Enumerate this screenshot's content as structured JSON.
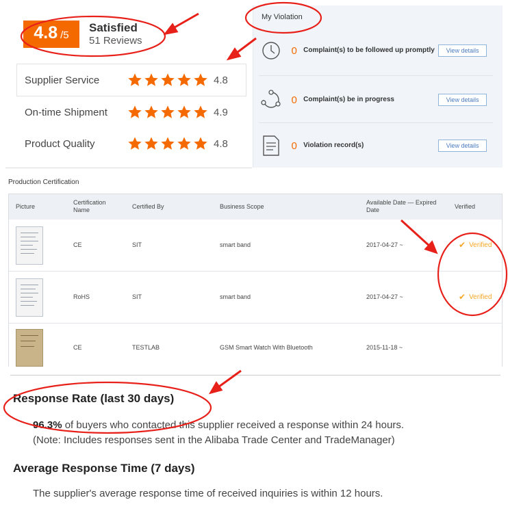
{
  "rating": {
    "score": "4.8",
    "out_of": "/5",
    "status": "Satisfied",
    "reviews": "51 Reviews",
    "metrics": [
      {
        "label": "Supplier Service",
        "value": "4.8",
        "stars": 5
      },
      {
        "label": "On-time Shipment",
        "value": "4.9",
        "stars": 5
      },
      {
        "label": "Product Quality",
        "value": "4.8",
        "stars": 5
      }
    ]
  },
  "violation": {
    "title": "My Violation",
    "items": [
      {
        "count": "0",
        "text": "Complaint(s) to be followed up promptly",
        "button": "View details",
        "icon": "clock-icon"
      },
      {
        "count": "0",
        "text": "Complaint(s) be in progress",
        "button": "View details",
        "icon": "cycle-icon"
      },
      {
        "count": "0",
        "text": "Violation record(s)",
        "button": "View details",
        "icon": "document-icon"
      }
    ]
  },
  "certification": {
    "title": "Production Certification",
    "headers": [
      "Picture",
      "Certification Name",
      "Certified By",
      "Business Scope",
      "Available Date — Expired Date",
      "Verified"
    ],
    "rows": [
      {
        "name": "CE",
        "by": "SIT",
        "scope": "smart band",
        "date": "2017-04-27 ~",
        "verified": "Verified"
      },
      {
        "name": "RoHS",
        "by": "SIT",
        "scope": "smart band",
        "date": "2017-04-27 ~",
        "verified": "Verified"
      },
      {
        "name": "CE",
        "by": "TESTLAB",
        "scope": "GSM Smart Watch With Bluetooth",
        "date": "2015-11-18 ~",
        "verified": ""
      }
    ]
  },
  "response": {
    "rate_heading": "Response Rate (last 30 days)",
    "rate_value": "96.3%",
    "rate_text": " of buyers who contacted this supplier received a response within 24 hours.",
    "rate_note": "(Note: Includes responses sent in the Alibaba Trade Center and TradeManager)",
    "time_heading": "Average Response Time (7 days)",
    "time_text": "The supplier's average response time of received inquiries is within 12 hours."
  },
  "colors": {
    "accent": "#f56a00",
    "star": "#f56a00",
    "annotation": "#e8201a",
    "verified": "#f5a623"
  }
}
